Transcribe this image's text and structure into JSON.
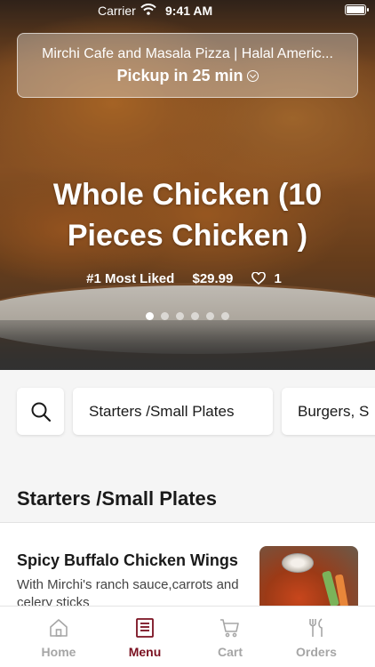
{
  "status_bar": {
    "carrier": "Carrier",
    "time": "9:41 AM"
  },
  "location": {
    "name": "Mirchi Cafe and Masala Pizza | Halal Americ...",
    "pickup": "Pickup in 25 min"
  },
  "hero": {
    "title": "Whole Chicken (10 Pieces Chicken )",
    "badge": "#1 Most Liked",
    "price": "$29.99",
    "likes": "1",
    "slide_count": 6,
    "active_slide": 1
  },
  "categories": {
    "items": [
      "Starters /Small Plates",
      "Burgers, S"
    ]
  },
  "section": {
    "title": "Starters /Small Plates",
    "items": [
      {
        "name": "Spicy Buffalo Chicken Wings",
        "description": "With Mirchi's ranch sauce,carrots and celery sticks"
      }
    ]
  },
  "tab_bar": {
    "tabs": [
      {
        "label": "Home",
        "icon": "home-icon",
        "active": false
      },
      {
        "label": "Menu",
        "icon": "menu-icon",
        "active": true
      },
      {
        "label": "Cart",
        "icon": "cart-icon",
        "active": false
      },
      {
        "label": "Orders",
        "icon": "orders-icon",
        "active": false
      }
    ]
  },
  "colors": {
    "accent": "#7a1020",
    "inactive_tab": "#a6a6a6",
    "background": "#f5f5f5"
  }
}
